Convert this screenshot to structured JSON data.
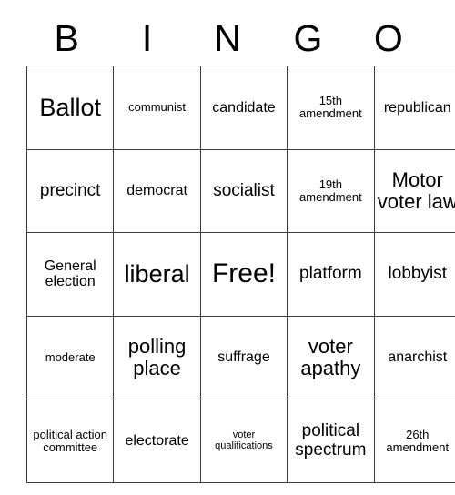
{
  "card": {
    "title": "BINGO",
    "header": {
      "letters": [
        "B",
        "I",
        "N",
        "G",
        "O"
      ]
    },
    "grid": {
      "columns": 5,
      "rows": 5,
      "free_space": {
        "row": 2,
        "column": 2,
        "label": "Free!"
      },
      "cells": [
        [
          {
            "text": "Ballot",
            "size": "xxl"
          },
          {
            "text": "communist",
            "size": "sm"
          },
          {
            "text": "candidate",
            "size": "md"
          },
          {
            "text": "15th amendment",
            "size": "sm"
          },
          {
            "text": "republican",
            "size": "md"
          }
        ],
        [
          {
            "text": "precinct",
            "size": "lg"
          },
          {
            "text": "democrat",
            "size": "md"
          },
          {
            "text": "socialist",
            "size": "lg"
          },
          {
            "text": "19th amendment",
            "size": "sm"
          },
          {
            "text": "Motor voter law",
            "size": "xl"
          }
        ],
        [
          {
            "text": "General election",
            "size": "md"
          },
          {
            "text": "liberal",
            "size": "xxl"
          },
          {
            "text": "Free!",
            "size": "free"
          },
          {
            "text": "platform",
            "size": "lg"
          },
          {
            "text": "lobbyist",
            "size": "lg"
          }
        ],
        [
          {
            "text": "moderate",
            "size": "sm"
          },
          {
            "text": "polling place",
            "size": "xl"
          },
          {
            "text": "suffrage",
            "size": "md"
          },
          {
            "text": "voter apathy",
            "size": "xl"
          },
          {
            "text": "anarchist",
            "size": "md"
          }
        ],
        [
          {
            "text": "political action committee",
            "size": "sm"
          },
          {
            "text": "electorate",
            "size": "md"
          },
          {
            "text": "voter qualifications",
            "size": "xs"
          },
          {
            "text": "political spectrum",
            "size": "lg"
          },
          {
            "text": "26th amendment",
            "size": "sm"
          }
        ]
      ]
    },
    "colors": {
      "background": "#ffffff",
      "border": "#3c3c3c",
      "text": "#000000"
    }
  }
}
